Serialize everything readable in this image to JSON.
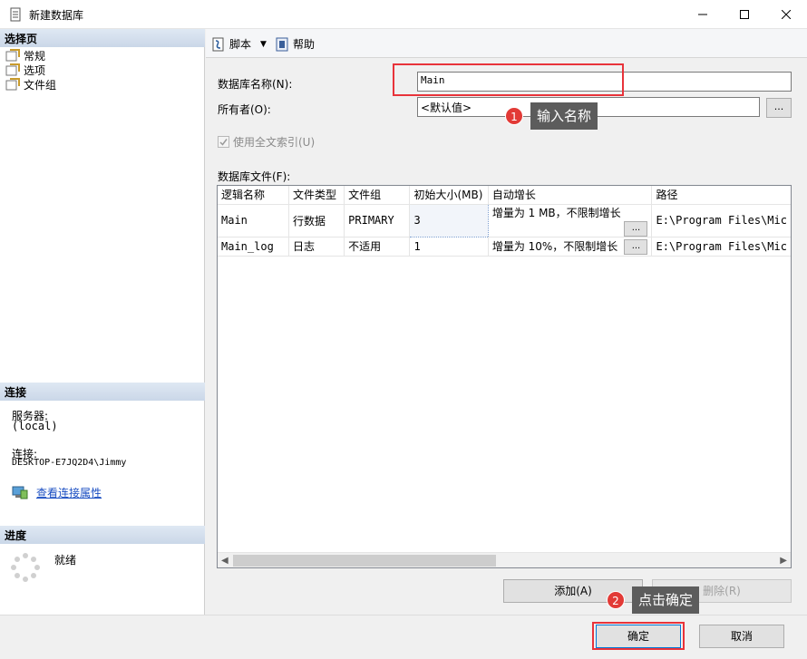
{
  "window": {
    "title": "新建数据库",
    "icon": "database-icon",
    "controls": [
      "minimize-icon",
      "maximize-icon",
      "close-icon"
    ]
  },
  "left_panel": {
    "select_page_header": "选择页",
    "pages": [
      {
        "label": "常规",
        "icon": "page-icon"
      },
      {
        "label": "选项",
        "icon": "page-icon"
      },
      {
        "label": "文件组",
        "icon": "page-icon"
      }
    ],
    "connection_header": "连接",
    "server_label": "服务器:",
    "server_value": "(local)",
    "connection_label": "连接:",
    "connection_value": "DESKTOP-E7JQ2D4\\Jimmy",
    "view_connection_link": "查看连接属性",
    "progress_header": "进度",
    "progress_status": "就绪"
  },
  "toolbar": {
    "script_label": "脚本",
    "help_label": "帮助"
  },
  "form": {
    "db_name_label": "数据库名称(N):",
    "db_name_value": "Main",
    "owner_label": "所有者(O):",
    "owner_value": "<默认值>",
    "owner_browse": "...",
    "fulltext_label": "使用全文索引(U)",
    "fulltext_checked": true,
    "db_files_label": "数据库文件(F):"
  },
  "files_table": {
    "columns": [
      "逻辑名称",
      "文件类型",
      "文件组",
      "初始大小(MB)",
      "自动增长",
      "路径"
    ],
    "rows": [
      {
        "logical_name": "Main",
        "file_type": "行数据",
        "filegroup": "PRIMARY",
        "initial_size": "3",
        "autogrowth": "增量为 1 MB，不限制增长",
        "path": "E:\\Program Files\\Mic"
      },
      {
        "logical_name": "Main_log",
        "file_type": "日志",
        "filegroup": "不适用",
        "initial_size": "1",
        "autogrowth": "增量为 10%，不限制增长",
        "path": "E:\\Program Files\\Mic"
      }
    ],
    "ellipsis": "..."
  },
  "buttons": {
    "add": "添加(A)",
    "remove": "删除(R)",
    "ok": "确定",
    "cancel": "取消"
  },
  "annotations": [
    {
      "number": "1",
      "text": "输入名称"
    },
    {
      "number": "2",
      "text": "点击确定"
    }
  ],
  "colors": {
    "highlight": "#e8333a",
    "callout_bg": "#5c5c5c",
    "badge": "#e23a36",
    "link": "#1a4ec2"
  }
}
